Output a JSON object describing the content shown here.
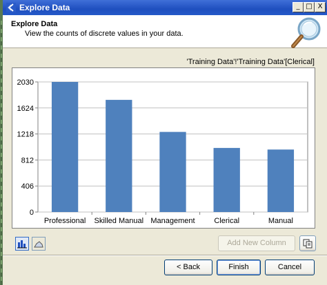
{
  "window": {
    "title": "Explore Data",
    "min_glyph": "_",
    "max_glyph": "□",
    "close_glyph": "X"
  },
  "header": {
    "title": "Explore Data",
    "description": "View the counts of discrete values in your data."
  },
  "column_path": "'Training Data'!'Training Data'[Clerical]",
  "toolbar": {
    "add_column_label": "Add New Column",
    "back_label": "< Back",
    "finish_label": "Finish",
    "cancel_label": "Cancel"
  },
  "icons": {
    "app": "app-logo-icon",
    "magnifier": "magnifier-icon",
    "bar_chart": "bar-chart-icon",
    "line_chart": "line-chart-icon",
    "copy": "copy-icon"
  },
  "colors": {
    "bar": "#4f81bd",
    "titlebar": "#1f4fbf"
  },
  "chart_data": {
    "type": "bar",
    "categories": [
      "Professional",
      "Skilled Manual",
      "Management",
      "Clerical",
      "Manual"
    ],
    "values": [
      2030,
      1750,
      1250,
      1000,
      975
    ],
    "ylim": [
      0,
      2030
    ],
    "yticks": [
      "0",
      "406",
      "812",
      "1218",
      "1624",
      "2030"
    ],
    "grid": true,
    "title": "",
    "xlabel": "",
    "ylabel": ""
  }
}
